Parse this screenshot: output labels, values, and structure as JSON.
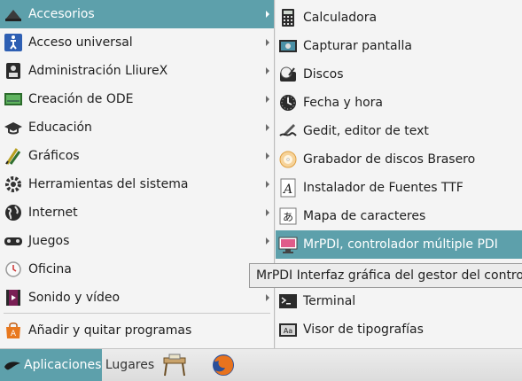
{
  "main_menu": {
    "items": [
      {
        "label": "Accesorios",
        "icon": "accessories-icon"
      },
      {
        "label": "Acceso universal",
        "icon": "accessibility-icon"
      },
      {
        "label": "Administración LliureX",
        "icon": "lliurex-admin-icon"
      },
      {
        "label": "Creación de ODE",
        "icon": "ode-creation-icon"
      },
      {
        "label": "Educación",
        "icon": "education-icon"
      },
      {
        "label": "Gráficos",
        "icon": "graphics-icon"
      },
      {
        "label": "Herramientas del sistema",
        "icon": "system-tools-icon"
      },
      {
        "label": "Internet",
        "icon": "internet-globe-icon"
      },
      {
        "label": "Juegos",
        "icon": "gamepad-icon"
      },
      {
        "label": "Oficina",
        "icon": "office-icon"
      },
      {
        "label": "Sonido y vídeo",
        "icon": "multimedia-icon"
      }
    ],
    "add_remove": {
      "label": "Añadir y quitar programas",
      "icon": "software-center-icon"
    }
  },
  "submenu": {
    "items": [
      {
        "label": "Calculadora",
        "icon": "calculator-icon"
      },
      {
        "label": "Capturar pantalla",
        "icon": "screenshot-icon"
      },
      {
        "label": "Discos",
        "icon": "disk-utility-icon"
      },
      {
        "label": "Fecha y hora",
        "icon": "clock-icon"
      },
      {
        "label": "Gedit, editor de text",
        "icon": "text-editor-icon"
      },
      {
        "label": "Grabador de discos Brasero",
        "icon": "brasero-icon"
      },
      {
        "label": "Instalador de Fuentes TTF",
        "icon": "font-installer-icon"
      },
      {
        "label": "Mapa de caracteres",
        "icon": "character-map-icon"
      },
      {
        "label": "MrPDI, controlador múltiple PDI",
        "icon": "mrpdi-icon"
      },
      {
        "label": "Terminal",
        "icon": "terminal-icon"
      },
      {
        "label": "Visor de tipografías",
        "icon": "font-viewer-icon"
      }
    ]
  },
  "tooltip": "MrPDI Interfaz gráfica del gestor del controlador",
  "panel": {
    "applications_label": "Aplicaciones",
    "places_label": "Lugares",
    "launchers": [
      "classroom-launcher-icon",
      "firefox-icon"
    ]
  },
  "colors": {
    "highlight": "#5da0ab",
    "menu_bg": "#f4f4f4",
    "highlight_text": "#ffffff"
  }
}
